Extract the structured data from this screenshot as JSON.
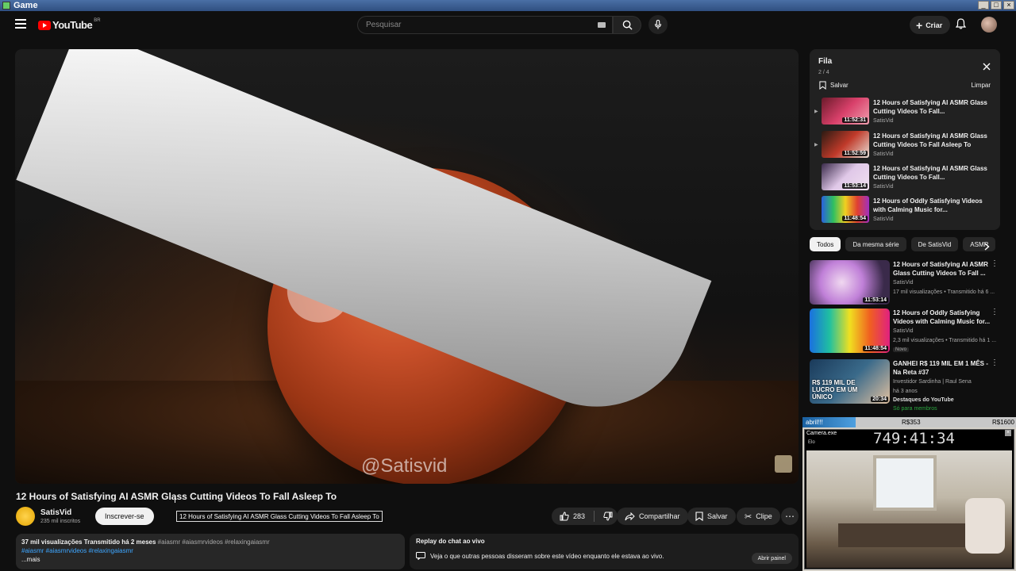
{
  "window": {
    "title": "Game"
  },
  "header": {
    "logo_text": "YouTube",
    "logo_country": "BR",
    "search_placeholder": "Pesquisar",
    "create_label": "Criar"
  },
  "video": {
    "watermark": "@Satisvid",
    "title": "12 Hours of Satisfying AI ASMR Glass Cutting Videos To Fall Asleep To",
    "tooltip": "12 Hours of Satisfying AI ASMR Glass Cutting Videos To Fall Asleep To",
    "channel_name": "SatisVid",
    "channel_subs": "235 mil inscritos",
    "subscribe_label": "Inscrever-se",
    "likes": "283",
    "share_label": "Compartilhar",
    "save_label": "Salvar",
    "clip_label": "Clipe"
  },
  "description": {
    "stats": "37 mil visualizações  Transmitido há 2 meses",
    "tags_inline": "#aiasmr #aiasmrvideos #relaxingaiasmr",
    "tags_blue": "#aiasmr #aiasmrvideos #relaxingaiasmr",
    "more": "...mais"
  },
  "chat_replay": {
    "title": "Replay do chat ao vivo",
    "text": "Veja o que outras pessoas disseram sobre este vídeo enquanto ele estava ao vivo.",
    "button": "Abrir painel"
  },
  "queue": {
    "title": "Fila",
    "count": "2 / 4",
    "save_label": "Salvar",
    "clear_label": "Limpar",
    "items": [
      {
        "title": "12 Hours of Satisfying AI ASMR Glass Cutting Videos To Fall...",
        "channel": "SatisVid",
        "duration": "11:52:31"
      },
      {
        "title": "12 Hours of Satisfying AI ASMR Glass Cutting Videos To Fall Asleep To",
        "channel": "SatisVid",
        "duration": "11:52:59"
      },
      {
        "title": "12 Hours of Satisfying AI ASMR Glass Cutting Videos To Fall...",
        "channel": "SatisVid",
        "duration": "11:53:14"
      },
      {
        "title": "12 Hours of Oddly Satisfying Videos with Calming Music for...",
        "channel": "SatisVid",
        "duration": "11:48:54"
      }
    ]
  },
  "chips": [
    "Todos",
    "Da mesma série",
    "De SatisVid",
    "ASMR"
  ],
  "recommendations": [
    {
      "title": "12 Hours of Satisfying AI ASMR Glass Cutting Videos To Fall ...",
      "channel": "SatisVid",
      "meta": "17 mil visualizações • Transmitido há 6 ...",
      "duration": "11:53:14"
    },
    {
      "title": "12 Hours of Oddly Satisfying Videos with Calming Music for...",
      "channel": "SatisVid",
      "meta": "2,3 mil visualizações • Transmitido há 1 ...",
      "badge": "Novo",
      "duration": "11:48:54"
    },
    {
      "title": "GANHEI R$ 119 MIL EM 1 MÊS - Na Reta #37",
      "channel": "Investidor Sardinha | Raul Sena",
      "meta": "há 3 anos",
      "extra": "Destaques do YouTube",
      "members": "Só para membros",
      "duration": "20:34",
      "thumb_text": "R$ 119 MIL DE LUCRO EM UM ÚNICO"
    }
  ],
  "stream_overlay": {
    "label_left": "abril!!!",
    "label_mid": "R$353",
    "label_right": "R$1600",
    "cam_title": "Camera.exe",
    "timer": "749:41:34",
    "sub": "Elo"
  },
  "colors": {
    "accent_red": "#ff0000",
    "link_blue": "#3ea6ff",
    "bg": "#0f0f0f"
  }
}
